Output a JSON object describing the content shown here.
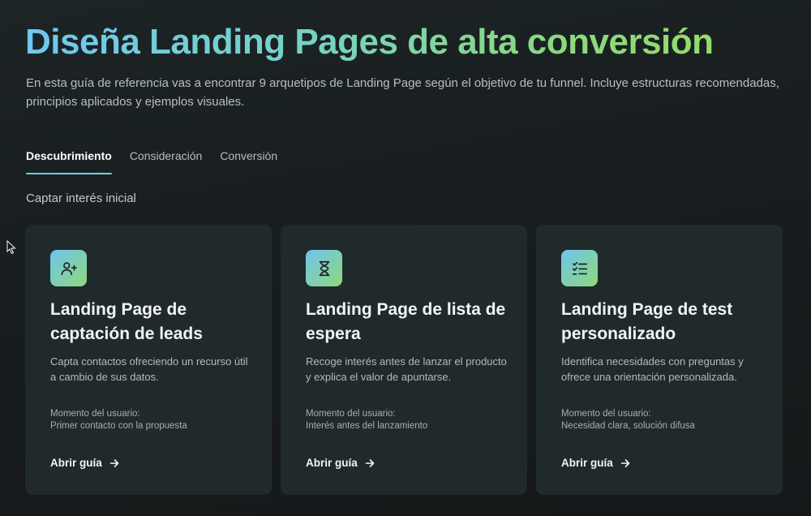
{
  "header": {
    "title": "Diseña Landing Pages de alta conversión",
    "subtitle": "En esta guía de referencia vas a encontrar 9 arquetipos de Landing Page según el objetivo de tu funnel. Incluye estructuras recomendadas, principios aplicados y ejemplos visuales."
  },
  "tabs": [
    {
      "label": "Descubrimiento",
      "active": true
    },
    {
      "label": "Consideración",
      "active": false
    },
    {
      "label": "Conversión",
      "active": false
    }
  ],
  "section": {
    "label": "Captar interés inicial"
  },
  "cards": [
    {
      "icon": "user-plus-icon",
      "title": "Landing Page de captación de leads",
      "description": "Capta contactos ofreciendo un recurso útil a cambio de sus datos.",
      "moment_label": "Momento del usuario:",
      "moment_value": "Primer contacto con la propuesta",
      "link_label": "Abrir guía"
    },
    {
      "icon": "hourglass-icon",
      "title": "Landing Page de lista de espera",
      "description": "Recoge interés antes de lanzar el producto y explica el valor de apuntarse.",
      "moment_label": "Momento del usuario:",
      "moment_value": "Interés antes del lanzamiento",
      "link_label": "Abrir guía"
    },
    {
      "icon": "checklist-icon",
      "title": "Landing Page de test personalizado",
      "description": "Identifica necesidades con preguntas y ofrece una orientación personalizada.",
      "moment_label": "Momento del usuario:",
      "moment_value": "Necesidad clara, solución difusa",
      "link_label": "Abrir guía"
    }
  ],
  "colors": {
    "background": "#1a2021",
    "card": "#212a2b",
    "accent_blue": "#6fc8f0",
    "accent_green": "#96dc6a"
  }
}
